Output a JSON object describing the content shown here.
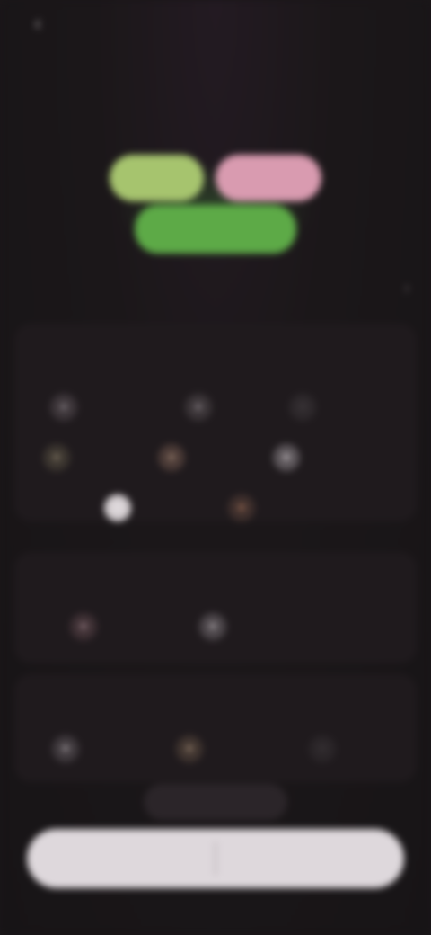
{
  "header": {
    "back_icon": "arrow-left-icon",
    "back_label": "",
    "action_label": ""
  },
  "title": "",
  "hero": {
    "colors": [
      "#a6c46e",
      "#d99bb0",
      "#5daa47"
    ]
  },
  "section": {
    "title": "",
    "subtitle": ""
  },
  "groups": [
    {
      "label": "",
      "chips": [
        {
          "icon": "circle-icon",
          "label": ""
        },
        {
          "icon": "circle-icon",
          "label": ""
        },
        {
          "icon": "circle-icon",
          "label": ""
        },
        {
          "icon": "circle-icon",
          "label": ""
        },
        {
          "icon": "circle-icon",
          "label": ""
        },
        {
          "icon": "circle-icon",
          "label": ""
        },
        {
          "icon": "circle-icon",
          "label": ""
        },
        {
          "icon": "circle-icon",
          "label": ""
        }
      ]
    },
    {
      "label": "",
      "chips": [
        {
          "icon": "circle-icon",
          "label": ""
        },
        {
          "icon": "circle-icon",
          "label": ""
        }
      ]
    },
    {
      "label": "",
      "chips": [
        {
          "icon": "circle-icon",
          "label": ""
        },
        {
          "icon": "circle-icon",
          "label": ""
        },
        {
          "icon": "circle-icon",
          "label": ""
        }
      ]
    }
  ],
  "floating": {
    "label": ""
  },
  "bottom": {
    "left_label": "",
    "right_label": ""
  }
}
